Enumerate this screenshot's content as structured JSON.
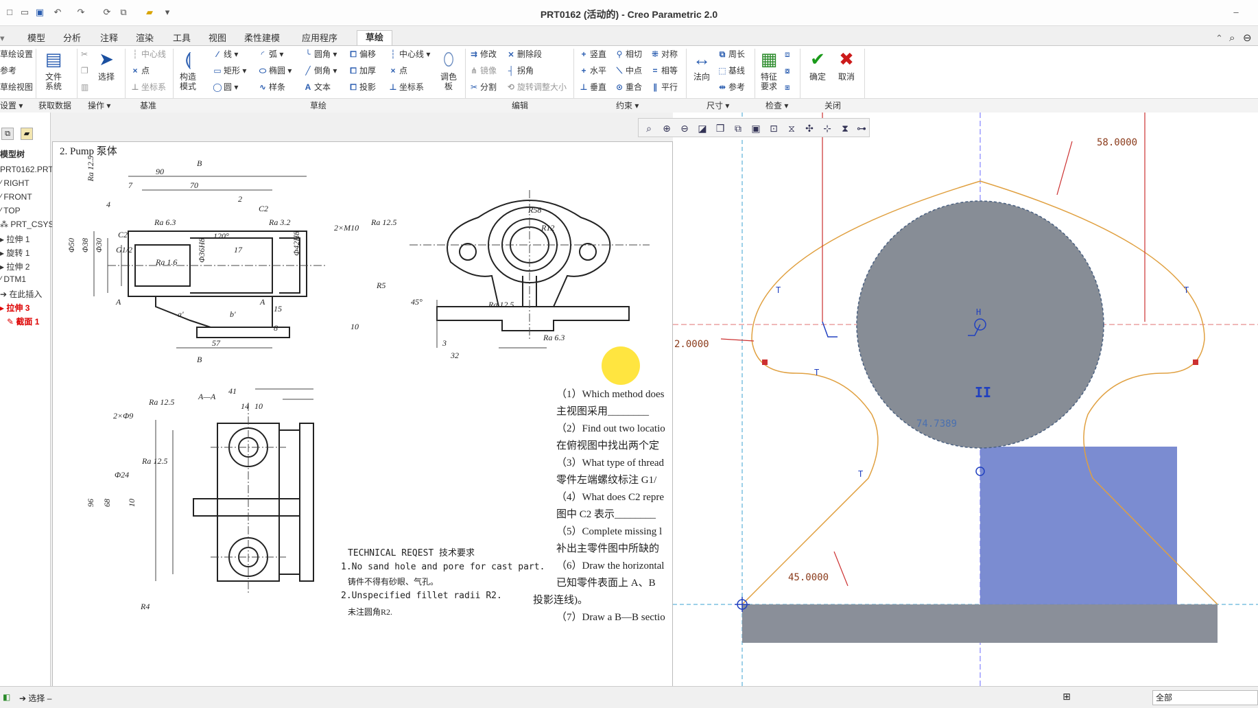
{
  "window": {
    "title": "PRT0162 (活动的) - Creo Parametric 2.0"
  },
  "tabs": [
    "模型",
    "分析",
    "注释",
    "渲染",
    "工具",
    "视图",
    "柔性建模",
    "应用程序",
    "草绘"
  ],
  "active_tab": "草绘",
  "ribbon": {
    "setup": {
      "items": [
        "草绘设置",
        "参考",
        "草绘视图"
      ],
      "group": "设置"
    },
    "get_data": {
      "file_system": "文件系统",
      "group": "获取数据"
    },
    "operations": {
      "select": "选择",
      "group": "操作"
    },
    "datum": {
      "items": [
        "中心线",
        "点",
        "坐标系"
      ],
      "group": "基准"
    },
    "sketch": {
      "construction_mode": "构造模式",
      "col1": [
        "线",
        "矩形",
        "圆"
      ],
      "col2": [
        "弧",
        "椭圆",
        "样条"
      ],
      "col3": [
        "圆角",
        "倒角",
        "文本"
      ],
      "col4": [
        "偏移",
        "加厚",
        "投影"
      ],
      "col5": [
        "中心线",
        "点",
        "坐标系"
      ],
      "palette": "调色板",
      "group": "草绘"
    },
    "edit": {
      "col1": [
        "修改",
        "镜像",
        "分割"
      ],
      "col2": [
        "删除段",
        "拐角",
        "旋转调整大小"
      ],
      "group": "编辑"
    },
    "constrain": {
      "col1": [
        "竖直",
        "水平",
        "垂直"
      ],
      "col2": [
        "相切",
        "中点",
        "重合"
      ],
      "col3": [
        "对称",
        "相等",
        "平行"
      ],
      "group": "约束"
    },
    "dimension": {
      "normal": "法向",
      "items": [
        "周长",
        "基线",
        "参考"
      ],
      "group": "尺寸"
    },
    "inspect": {
      "feature_req": "特征要求",
      "group": "检查"
    },
    "close": {
      "ok": "确定",
      "cancel": "取消",
      "group": "关闭"
    }
  },
  "model_tree": {
    "header": "模型树",
    "items": [
      "PRT0162.PRT",
      "RIGHT",
      "FRONT",
      "TOP",
      "PRT_CSYS_DEF",
      "拉伸 1",
      "旋转 1",
      "拉伸 2",
      "DTM1",
      "在此插入",
      "拉伸 3",
      "截面 1"
    ]
  },
  "document": {
    "heading": "2. Pump 泵体",
    "questions": [
      "（1）Which method does",
      "主视图采用________",
      "（2）Find out two locatio",
      "在俯视图中找出两个定",
      "（3）What type of thread",
      "零件左端螺纹标注 G1/",
      "（4）What does C2 repre",
      "图中 C2 表示________",
      "（5）Complete missing l",
      "补出主零件图中所缺的",
      "（6）Draw the horizontal",
      "已知零件表面上 A、B",
      "投影连线)。",
      "（7）Draw a B—B sectio"
    ],
    "tech_req": [
      "TECHNICAL REQEST 技术要求",
      "1.No sand hole and pore for cast part.",
      "铸件不得有砂眼、气孔。",
      "2.Unspecified fillet radii R2.",
      "未注圆角R2."
    ],
    "dims_front": [
      "90",
      "70",
      "7",
      "4",
      "2",
      "C2",
      "Ra 12.5",
      "Ra 6.3",
      "Ra 3.2",
      "Ra 1.6",
      "C2",
      "G1/2",
      "Φ50",
      "Φ38",
      "Φ30",
      "Φ36H8",
      "Φ42H8",
      "120°",
      "17",
      "15",
      "8",
      "57",
      "a'",
      "b'",
      "A",
      "A",
      "B",
      "B"
    ],
    "dims_top": [
      "R58",
      "R12",
      "2×M10",
      "Ra 12.5",
      "R5",
      "45°",
      "Ra 12.5",
      "Ra 6.3",
      "10",
      "3",
      "32"
    ],
    "dims_section": [
      "A—A",
      "2×Φ9",
      "Ra 12.5",
      "41",
      "14",
      "10",
      "Φ24",
      "Ra 12.5",
      "96",
      "68",
      "10",
      "R4"
    ]
  },
  "sketch": {
    "dims": [
      "58.0000",
      "2.0000",
      "74.7389",
      "45.0000"
    ],
    "symbols": [
      "H",
      "T",
      "T",
      "T",
      "T",
      "II"
    ]
  },
  "status": {
    "filter": "全部"
  }
}
